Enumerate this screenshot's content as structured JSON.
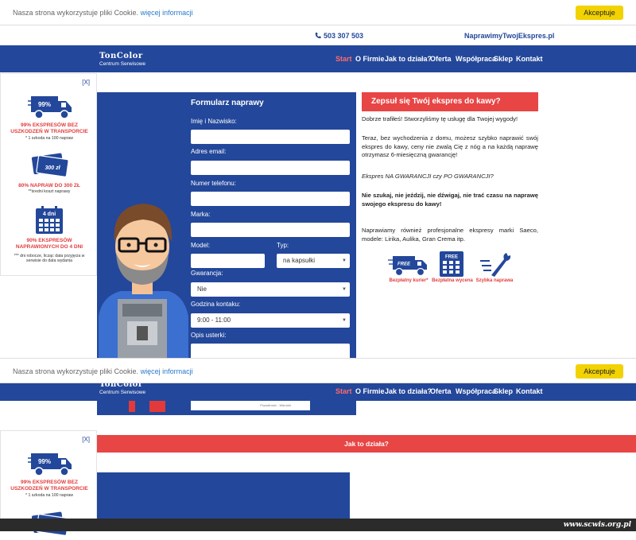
{
  "cookie": {
    "message": "Nasza strona wykorzystuje pliki Cookie.",
    "link": "więcej informacji",
    "accept": "Akceptuje"
  },
  "contact": {
    "phone": "503 307 503",
    "website": "NaprawimyTwojEkspres.pl"
  },
  "logo": {
    "brand": "TonColor",
    "subtitle": "Centrum Serwisowe"
  },
  "nav": [
    "Start",
    "O Firmie",
    "Jak to działa?",
    "Oferta",
    "Współpraca",
    "Sklep",
    "Kontakt"
  ],
  "promo": {
    "close": "[X]",
    "items": [
      {
        "icon": "truck-icon",
        "badge": "99%",
        "title": "99% EKSPRESÓW BEZ USZKODZEŃ W TRANSPORCIE",
        "note": "* 1 szkoda na 100 napraw"
      },
      {
        "icon": "money-icon",
        "badge": "300 zł",
        "title": "80% NAPRAW DO 300 ZŁ",
        "note": "**średni koszt naprawy"
      },
      {
        "icon": "calendar-icon",
        "badge": "4 dni",
        "title": "90% EKSPRESÓW NAPRAWIONYCH DO 4 DNI",
        "note": "*** dni robocze, licząc data przyjęcia w serwisie do data wydania"
      }
    ]
  },
  "form": {
    "title": "Formularz naprawy",
    "name_label": "Imię i Nazwisko:",
    "email_label": "Adres email:",
    "phone_label": "Numer telefonu:",
    "brand_label": "Marka:",
    "model_label": "Model:",
    "type_label": "Typ:",
    "type_value": "na kapsułki",
    "warranty_label": "Gwarancja:",
    "warranty_value": "Nie",
    "hours_label": "Godzina kontaku:",
    "hours_value": "9:00 - 11:00",
    "issue_label": "Opis usterki:",
    "captcha_text": "Prywatność - Warunki"
  },
  "info": {
    "headline": "Zepsuł się Twój ekspres do kawy?",
    "p1": "Dobrze trafiłeś! Stworzyliśmy tę usługę dla Twojej wygody!",
    "p2": "Teraz, bez wychodzenia z domu, możesz szybko naprawić swój ekspres do kawy, ceny nie zwalą Cię z nóg a na każdą naprawę otrzymasz 6-miesięczną gwarancję!",
    "p3": "Ekspres NA GWARANCJI czy PO GWARANCJI?",
    "p4": "Nie szukaj, nie jeździj, nie dźwigaj, nie trać czasu na naprawę swojego ekspresu do kawy!",
    "p5": "Naprawiamy również profesjonalne ekspresy marki Saeco, modele: Lirika, Aulika, Gran Crema itp.",
    "features": [
      {
        "icon": "free-truck-icon",
        "badge": "FREE",
        "label": "Bezpłatny kurier*"
      },
      {
        "icon": "free-calculator-icon",
        "badge": "FREE",
        "label": "Bezpłatna wycena"
      },
      {
        "icon": "wrench-icon",
        "label": "Szybka naprawa"
      }
    ]
  },
  "how_it_works": "Jak to działa?",
  "watermark": "www.scwis.org.pl",
  "colors": {
    "brand_blue": "#23479a",
    "accent_red": "#e84545",
    "cookie_yellow": "#f2d200"
  }
}
